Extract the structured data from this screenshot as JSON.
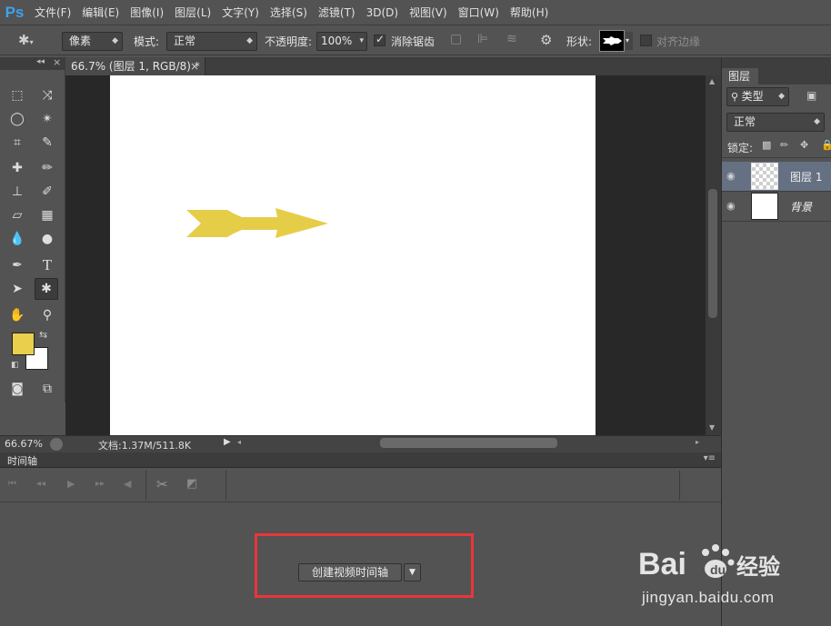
{
  "app": {
    "logo": "Ps"
  },
  "menu": [
    "文件(F)",
    "编辑(E)",
    "图像(I)",
    "图层(L)",
    "文字(Y)",
    "选择(S)",
    "滤镜(T)",
    "3D(D)",
    "视图(V)",
    "窗口(W)",
    "帮助(H)"
  ],
  "options": {
    "pixel_mode": "像素",
    "mode_label": "模式:",
    "mode_value": "正常",
    "opacity_label": "不透明度:",
    "opacity_value": "100%",
    "antialias_label": "消除锯齿",
    "antialias_checked": true,
    "shape_label": "形状:",
    "align_edges_label": "对齐边缘"
  },
  "document": {
    "tab_title": "66.7% (图层 1, RGB/8) *",
    "close_glyph": "×",
    "zoom": "66.67%",
    "doc_info": "文档:1.37M/511.8K",
    "shape_color": "#e6cd48"
  },
  "colors": {
    "foreground": "#e9cf4b",
    "background": "#ffffff"
  },
  "timeline": {
    "title": "时间轴",
    "create_button": "创建视频时间轴",
    "highlight_color": "#e8363a"
  },
  "layers_panel": {
    "tab": "图层",
    "filter_label": "类型",
    "blend_mode": "正常",
    "lock_label": "锁定:",
    "layers": [
      {
        "name": "图层 1",
        "selected": true,
        "transparent": true
      },
      {
        "name": "背景",
        "selected": false,
        "transparent": false
      }
    ]
  },
  "watermark": {
    "brand": "Bai du 经验",
    "url": "jingyan.baidu.com"
  }
}
